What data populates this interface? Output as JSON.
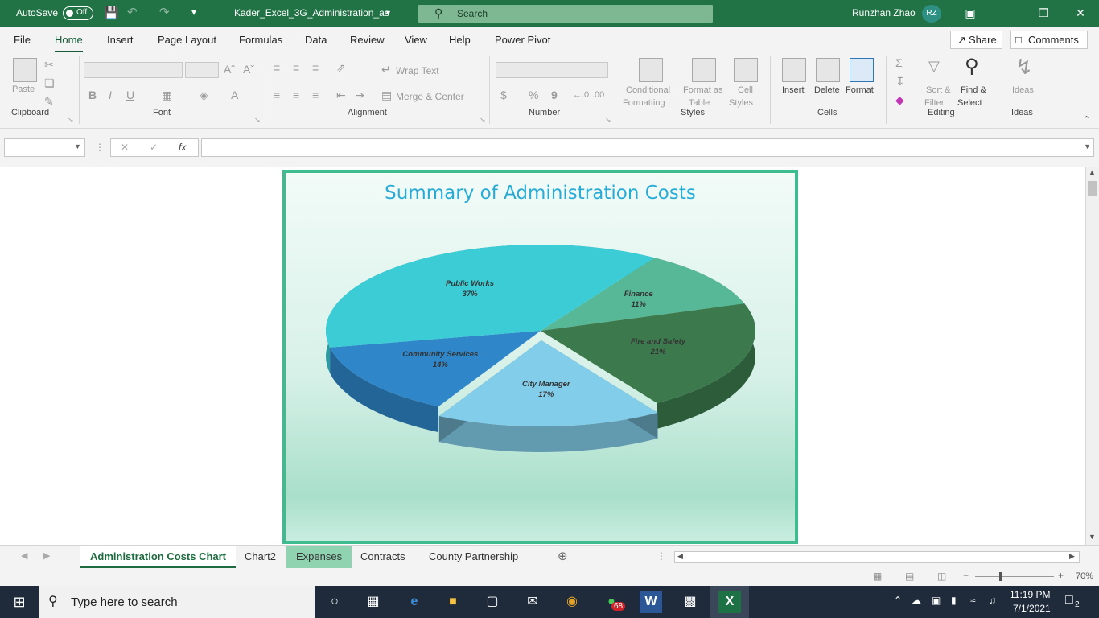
{
  "titlebar": {
    "autosave_label": "AutoSave",
    "autosave_state": "Off",
    "filename": "Kader_Excel_3G_Administration_as",
    "search_placeholder": "Search",
    "user_name": "Runzhan Zhao",
    "user_initials": "RZ"
  },
  "menu": {
    "tabs": [
      "File",
      "Home",
      "Insert",
      "Page Layout",
      "Formulas",
      "Data",
      "Review",
      "View",
      "Help",
      "Power Pivot"
    ],
    "active": "Home",
    "share_label": "Share",
    "comments_label": "Comments"
  },
  "ribbon": {
    "clipboard": {
      "paste": "Paste",
      "group": "Clipboard"
    },
    "font": {
      "bold": "B",
      "italic": "I",
      "underline": "U",
      "group": "Font"
    },
    "alignment": {
      "wrap_text": "Wrap Text",
      "merge_center": "Merge & Center",
      "group": "Alignment"
    },
    "number": {
      "currency": "$",
      "percent": "%",
      "comma": "9",
      "group": "Number"
    },
    "styles": {
      "conditional": "Conditional",
      "conditional2": "Formatting",
      "format_as": "Format as",
      "format_as2": "Table",
      "cell": "Cell",
      "cell2": "Styles",
      "group": "Styles"
    },
    "cells": {
      "insert": "Insert",
      "delete": "Delete",
      "format": "Format",
      "group": "Cells"
    },
    "editing": {
      "sort": "Sort &",
      "sort2": "Filter",
      "find": "Find &",
      "find2": "Select",
      "group": "Editing"
    },
    "ideas": {
      "ideas": "Ideas",
      "group": "Ideas"
    }
  },
  "formula_bar": {
    "fx": "fx",
    "name_box": "",
    "formula": ""
  },
  "chart_data": {
    "type": "pie",
    "title": "Summary of Administration Costs",
    "categories": [
      "Finance",
      "Fire and Safety",
      "City Manager",
      "Community Services",
      "Public Works"
    ],
    "values": [
      11,
      21,
      17,
      14,
      37
    ],
    "labels": [
      "11%",
      "21%",
      "17%",
      "14%",
      "37%"
    ],
    "colors": [
      "#57b897",
      "#3c7a4e",
      "#82cde9",
      "#2f86c9",
      "#3cccd6"
    ],
    "exploded": "City Manager",
    "legend": "none"
  },
  "sheet_tabs": {
    "tabs": [
      "Administration Costs Chart",
      "Chart2",
      "Expenses",
      "Contracts",
      "County Partnership"
    ],
    "active": "Administration Costs Chart",
    "colored": "Expenses"
  },
  "statusbar": {
    "zoom": "70%"
  },
  "taskbar": {
    "search_placeholder": "Type here to search",
    "time": "11:19 PM",
    "date": "7/1/2021",
    "whatsapp_badge": "68",
    "notification_count": "2"
  }
}
